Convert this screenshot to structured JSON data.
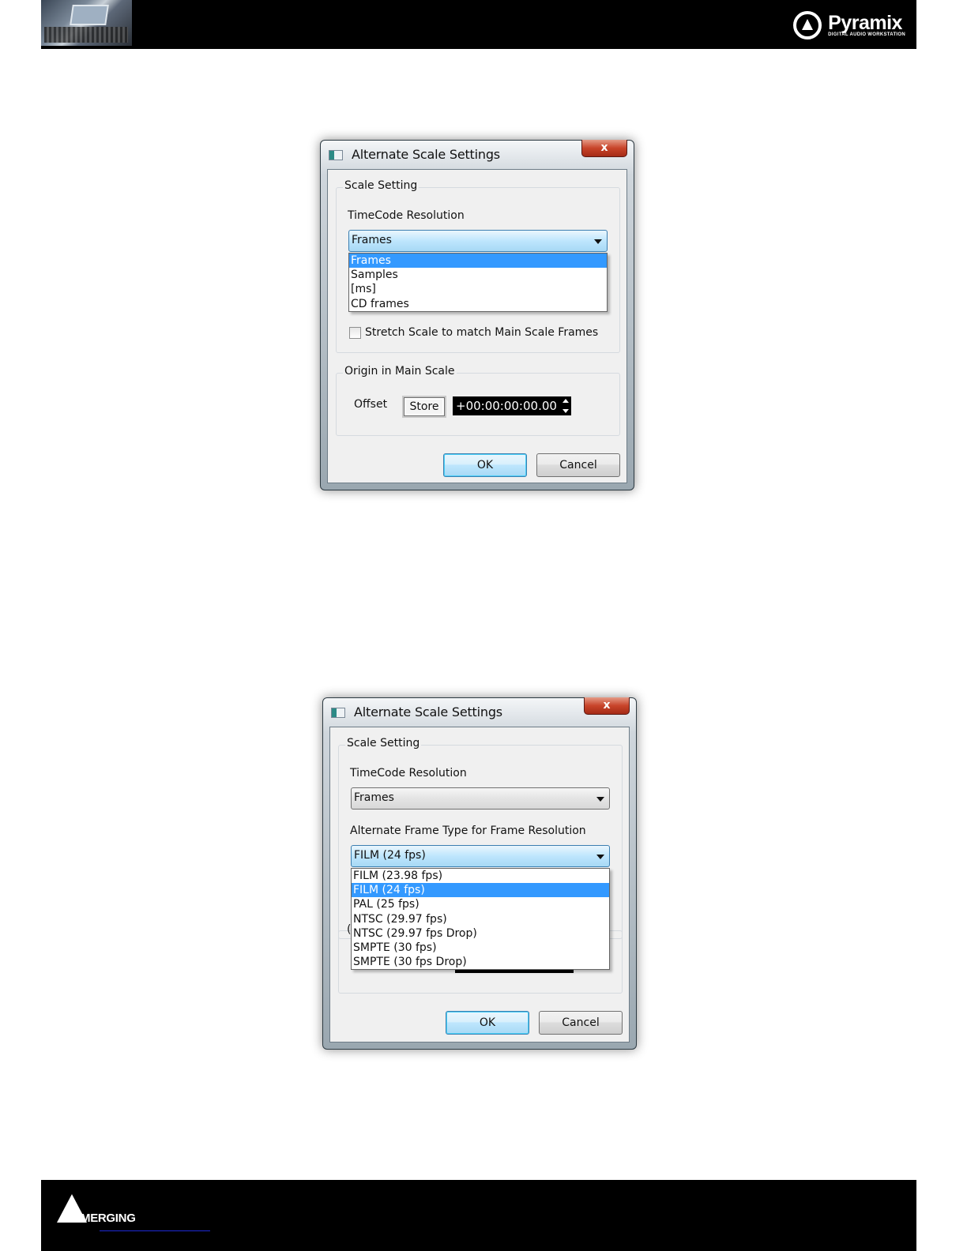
{
  "header": {
    "logo_name": "Pyramix",
    "logo_subtitle": "DIGITAL AUDIO WORKSTATION"
  },
  "footer": {
    "logo_name": "MERGING"
  },
  "dialog1": {
    "title": "Alternate Scale Settings",
    "close": "x",
    "scale_group": "Scale Setting",
    "timecode_label": "TimeCode Resolution",
    "timecode_value": "Frames",
    "timecode_options": [
      "Frames",
      "Samples",
      "[ms]",
      "CD frames"
    ],
    "timecode_selected_index": 0,
    "stretch_label": "Stretch Scale to match Main Scale Frames",
    "stretch_checked": false,
    "origin_group": "Origin in Main Scale",
    "offset_label": "Offset",
    "store_label": "Store",
    "offset_value": "+00:00:00:00.00",
    "ok_label": "OK",
    "cancel_label": "Cancel"
  },
  "dialog2": {
    "title": "Alternate Scale Settings",
    "close": "x",
    "scale_group": "Scale Setting",
    "timecode_label": "TimeCode Resolution",
    "timecode_value": "Frames",
    "frame_type_label": "Alternate Frame Type for Frame Resolution",
    "frame_type_value": "FILM (24 fps)",
    "frame_type_options": [
      "FILM (23.98 fps)",
      "FILM (24 fps)",
      "PAL  (25 fps)",
      "NTSC (29.97 fps)",
      "NTSC (29.97 fps Drop)",
      "SMPTE (30 fps)",
      "SMPTE (30 fps Drop)"
    ],
    "frame_type_selected_index": 1,
    "ok_label": "OK",
    "cancel_label": "Cancel"
  }
}
